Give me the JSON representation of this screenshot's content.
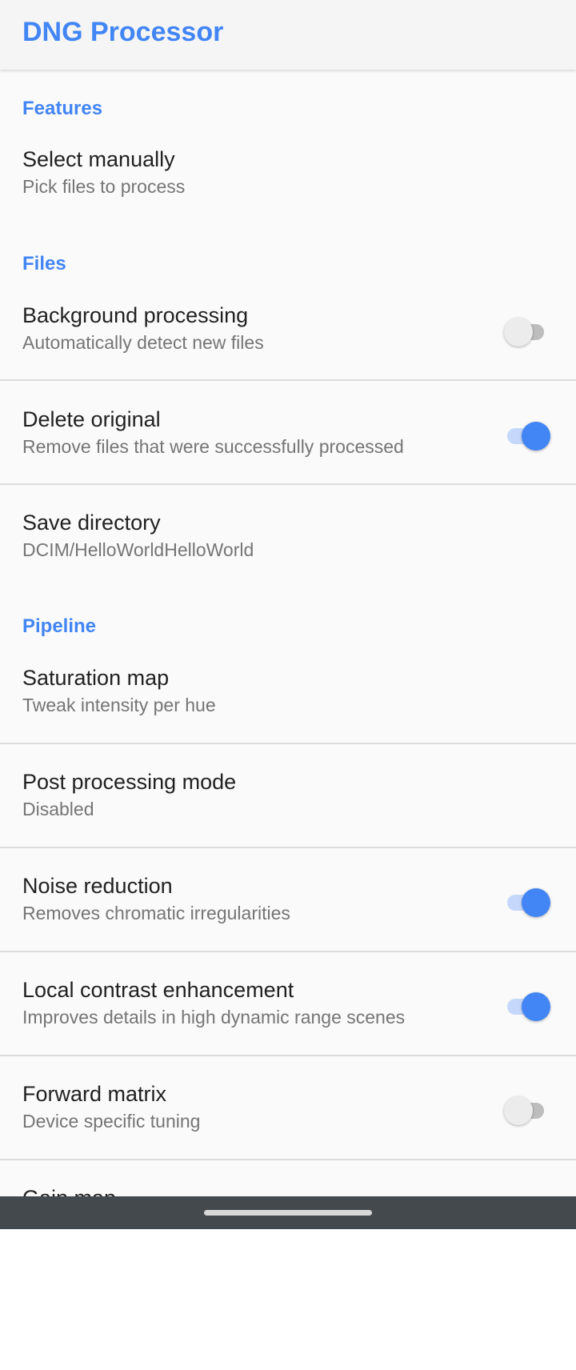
{
  "app": {
    "title": "DNG Processor"
  },
  "sections": {
    "features": "Features",
    "files": "Files",
    "pipeline": "Pipeline"
  },
  "prefs": {
    "select_manually": {
      "title": "Select manually",
      "summary": "Pick files to process"
    },
    "background_processing": {
      "title": "Background processing",
      "summary": "Automatically detect new files",
      "enabled": false
    },
    "delete_original": {
      "title": "Delete original",
      "summary": "Remove files that were successfully processed",
      "enabled": true
    },
    "save_directory": {
      "title": "Save directory",
      "summary": "DCIM/HelloWorldHelloWorld"
    },
    "saturation_map": {
      "title": "Saturation map",
      "summary": "Tweak intensity per hue"
    },
    "post_processing_mode": {
      "title": "Post processing mode",
      "summary": "Disabled"
    },
    "noise_reduction": {
      "title": "Noise reduction",
      "summary": "Removes chromatic irregularities",
      "enabled": true
    },
    "local_contrast": {
      "title": "Local contrast enhancement",
      "summary": "Improves details in high dynamic range scenes",
      "enabled": true
    },
    "forward_matrix": {
      "title": "Forward matrix",
      "summary": "Device specific tuning",
      "enabled": false
    },
    "gain_map": {
      "title": "Gain map"
    }
  },
  "colors": {
    "accent": "#4285f4",
    "navbar": "#44494e"
  }
}
